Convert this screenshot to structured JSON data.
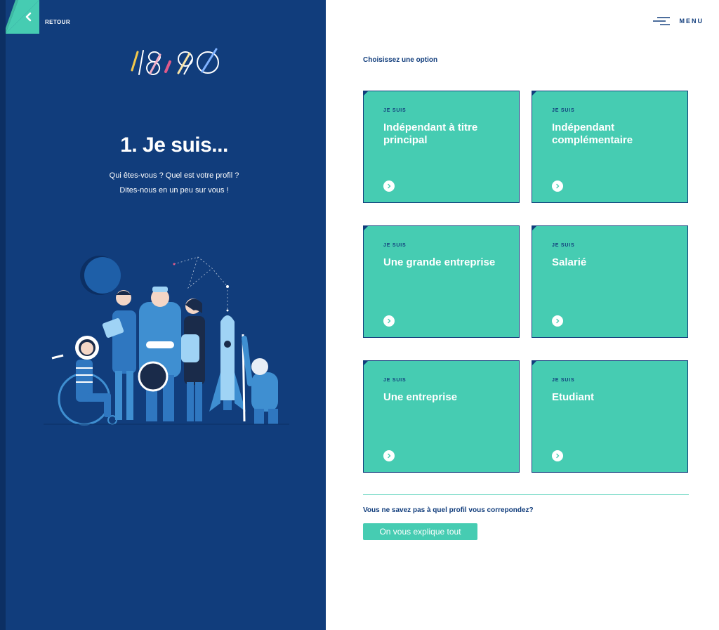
{
  "nav": {
    "back_label": "RETOUR",
    "menu_label": "MENU"
  },
  "brand": {
    "logo_text": "18,90"
  },
  "step": {
    "title": "1. Je suis...",
    "subtitle_line1": "Qui êtes-vous ? Quel est votre profil ?",
    "subtitle_line2": "Dites-nous en un peu sur vous !"
  },
  "options": {
    "heading": "Choisissez une option",
    "cards": [
      {
        "tag": "JE SUIS",
        "title": "Indépendant à titre principal"
      },
      {
        "tag": "JE SUIS",
        "title": "Indépendant complémentaire"
      },
      {
        "tag": "JE SUIS",
        "title": "Une grande entreprise"
      },
      {
        "tag": "JE SUIS",
        "title": "Salarié"
      },
      {
        "tag": "JE SUIS",
        "title": "Une entreprise"
      },
      {
        "tag": "JE SUIS",
        "title": "Etudiant"
      }
    ]
  },
  "help": {
    "question": "Vous ne savez pas à quel profil vous correpondez?",
    "button_label": "On vous explique tout"
  },
  "colors": {
    "navy": "#113d7c",
    "teal": "#46ccb2",
    "white": "#ffffff"
  },
  "icons": {
    "back": "chevron-left-icon",
    "menu": "hamburger-icon",
    "card_arrow": "chevron-right-circle-icon"
  }
}
